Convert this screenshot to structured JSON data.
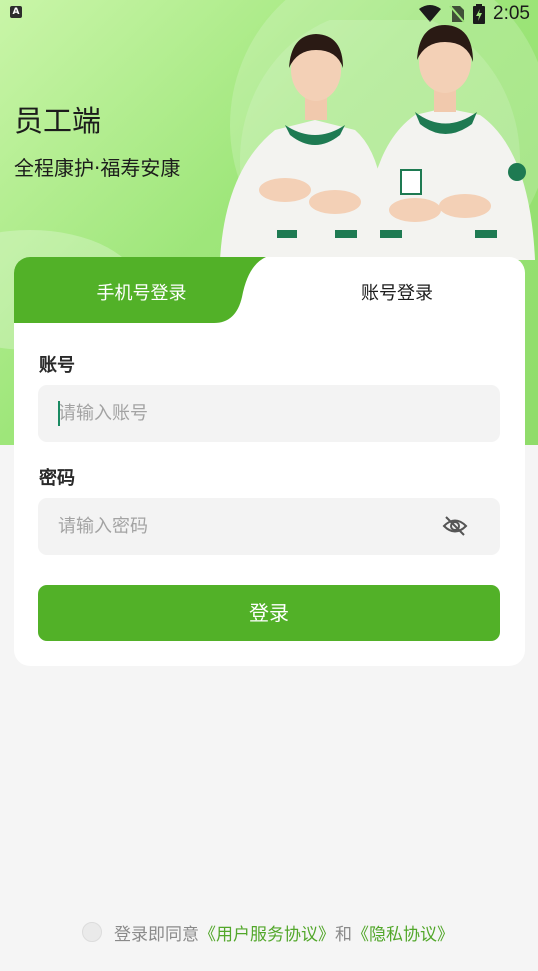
{
  "status_bar": {
    "time": "2:05",
    "notification_icon": "a-letter-icon"
  },
  "hero": {
    "title": "员工端",
    "subtitle": "全程康护·福寿安康"
  },
  "tabs": [
    {
      "label": "手机号登录",
      "active": true
    },
    {
      "label": "账号登录",
      "active": false
    }
  ],
  "form": {
    "account_label": "账号",
    "account_placeholder": "请输入账号",
    "password_label": "密码",
    "password_placeholder": "请输入密码",
    "login_button": "登录"
  },
  "agreement": {
    "prefix": "登录即同意",
    "user_agreement": "《用户服务协议》",
    "conjunction": "和",
    "privacy_policy": "《隐私协议》"
  },
  "colors": {
    "brand_green": "#52b128",
    "link_green": "#52a72a"
  }
}
